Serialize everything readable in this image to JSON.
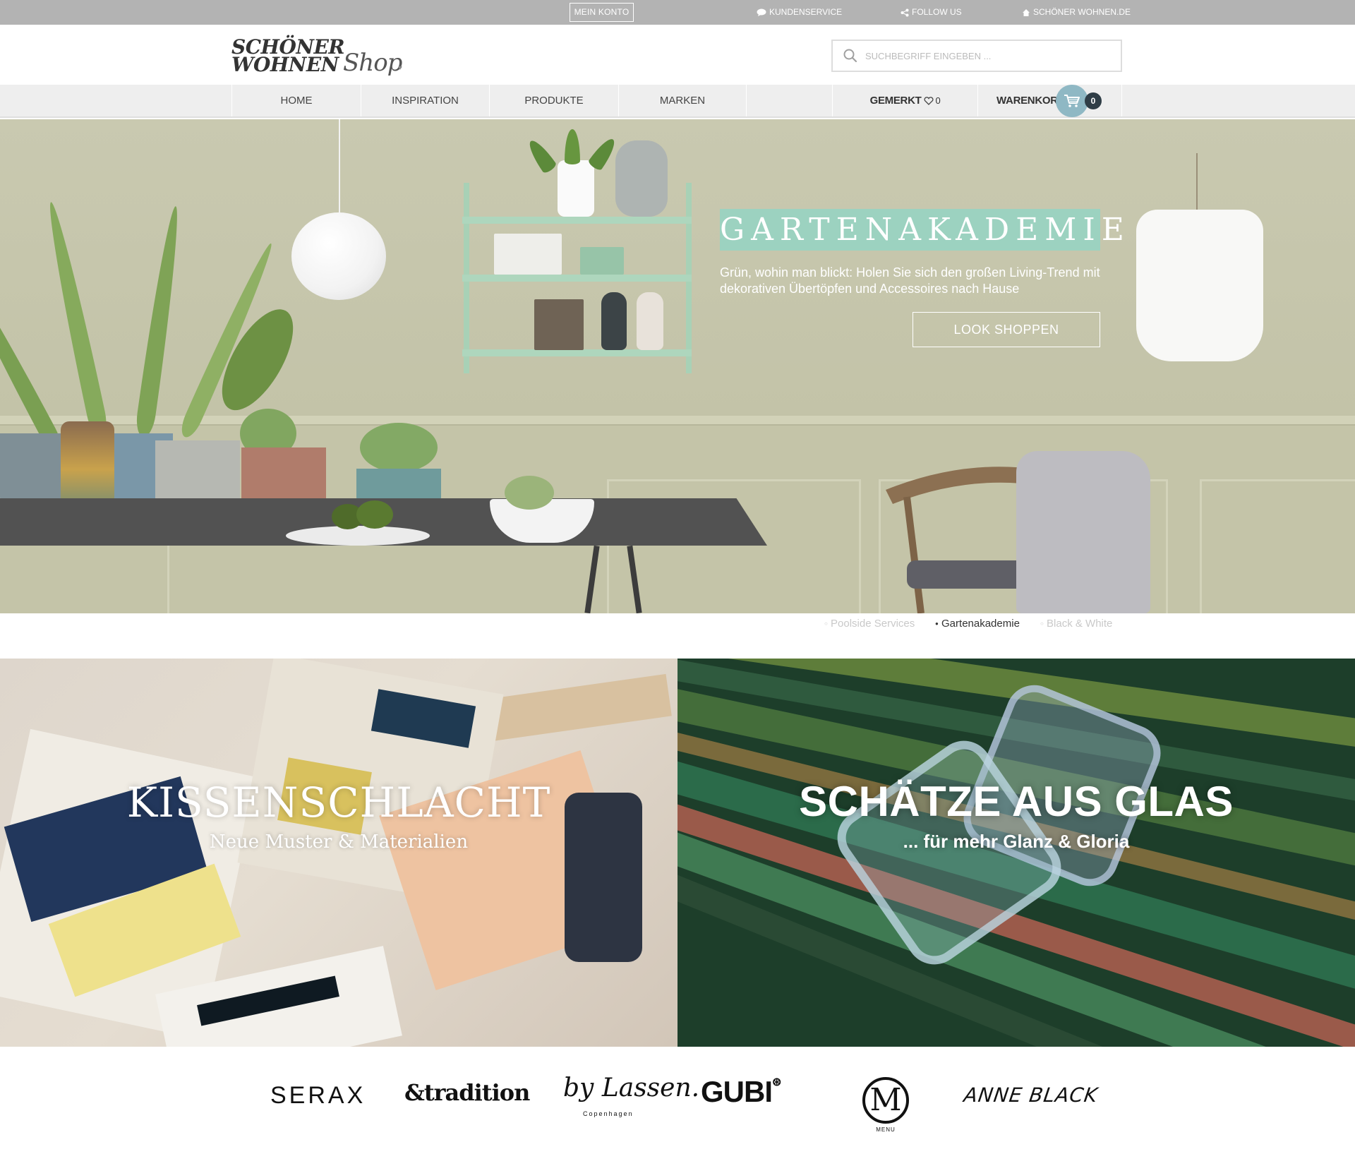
{
  "topbar": {
    "mein_konto": "MEIN KONTO",
    "kundenservice": "KUNDENSERVICE",
    "follow_us": "FOLLOW US",
    "schoener_wohnen": "SCHÖNER WOHNEN.DE"
  },
  "header": {
    "logo_line1": "SCHÖNER",
    "logo_line2": "WOHNEN",
    "logo_script": "Shop",
    "search_placeholder": "SUCHBEGRIFF EINGEBEN ..."
  },
  "nav": {
    "items": [
      "HOME",
      "INSPIRATION",
      "PRODUKTE",
      "MARKEN"
    ],
    "gemerkt_label": "GEMERKT",
    "gemerkt_count": "0",
    "warenkorb_label": "WARENKORB",
    "warenkorb_count": "0"
  },
  "hero": {
    "title": "GARTENAKADEMIE",
    "subtitle": "Grün, wohin man blickt: Holen Sie sich den großen Living-Trend mit dekorativen Übertöpfen und Accessoires nach Hause",
    "cta": "LOOK SHOPPEN"
  },
  "slider": {
    "items": [
      "Poolside Services",
      "Gartenakademie",
      "Black & White"
    ],
    "active": "Gartenakademie"
  },
  "tiles": {
    "left_title": "KISSENSCHLACHT",
    "left_subtitle": "Neue Muster & Materialien",
    "right_title": "SCHÄTZE AUS GLAS",
    "right_subtitle": "... für mehr Glanz & Gloria"
  },
  "brands": {
    "serax": "SERAX",
    "tradition": "&tradition",
    "lassen": "by Lassen.",
    "lassen_sub": "Copenhagen",
    "gubi": "GUBI",
    "menu": "MENU",
    "menu_mark": "M",
    "anne_black": "ANNE BLACK"
  },
  "colors": {
    "topbar": "#b3b3b3",
    "nav_bg": "#eeeeee",
    "hero_accent": "#9cd2c0",
    "cart_circle": "#8fb8c4",
    "cart_badge": "#2f3d46"
  }
}
